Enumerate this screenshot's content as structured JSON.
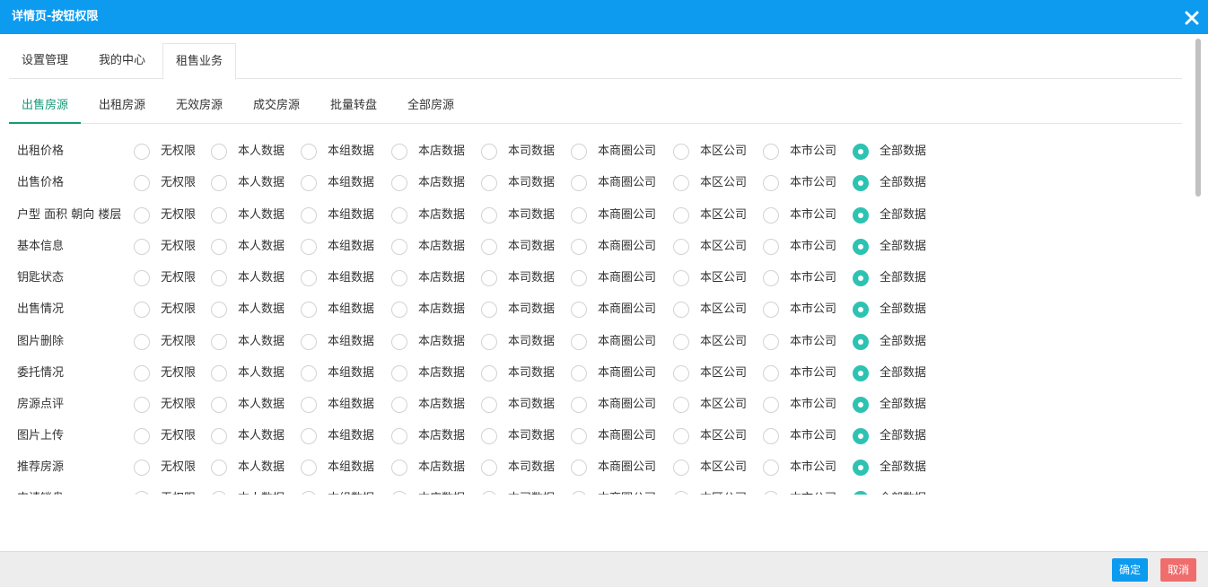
{
  "dialog": {
    "title": "详情页-按钮权限",
    "close_icon": "close-icon"
  },
  "top_tabs": [
    {
      "label": "设置管理",
      "active": false
    },
    {
      "label": "我的中心",
      "active": false
    },
    {
      "label": "租售业务",
      "active": true
    }
  ],
  "sub_tabs": [
    {
      "label": "出售房源",
      "active": true
    },
    {
      "label": "出租房源",
      "active": false
    },
    {
      "label": "无效房源",
      "active": false
    },
    {
      "label": "成交房源",
      "active": false
    },
    {
      "label": "批量转盘",
      "active": false
    },
    {
      "label": "全部房源",
      "active": false
    }
  ],
  "options": [
    "无权限",
    "本人数据",
    "本组数据",
    "本店数据",
    "本司数据",
    "本商圈公司",
    "本区公司",
    "本市公司",
    "全部数据"
  ],
  "rows": [
    {
      "label": "出租价格",
      "selected": 8
    },
    {
      "label": "出售价格",
      "selected": 8
    },
    {
      "label": "户型 面积 朝向 楼层",
      "selected": 8
    },
    {
      "label": "基本信息",
      "selected": 8
    },
    {
      "label": "钥匙状态",
      "selected": 8
    },
    {
      "label": "出售情况",
      "selected": 8
    },
    {
      "label": "图片删除",
      "selected": 8
    },
    {
      "label": "委托情况",
      "selected": 8
    },
    {
      "label": "房源点评",
      "selected": 8
    },
    {
      "label": "图片上传",
      "selected": 8
    },
    {
      "label": "推荐房源",
      "selected": 8
    },
    {
      "label": "申请锁盘",
      "selected": 8
    }
  ],
  "footer": {
    "ok_label": "确定",
    "cancel_label": "取消"
  },
  "colors": {
    "titlebar": "#0c9bef",
    "accent_tab": "#159a78",
    "radio_on": "#2ec2b2",
    "ok_button": "#0c9bef",
    "cancel_button": "#f06d6d"
  }
}
